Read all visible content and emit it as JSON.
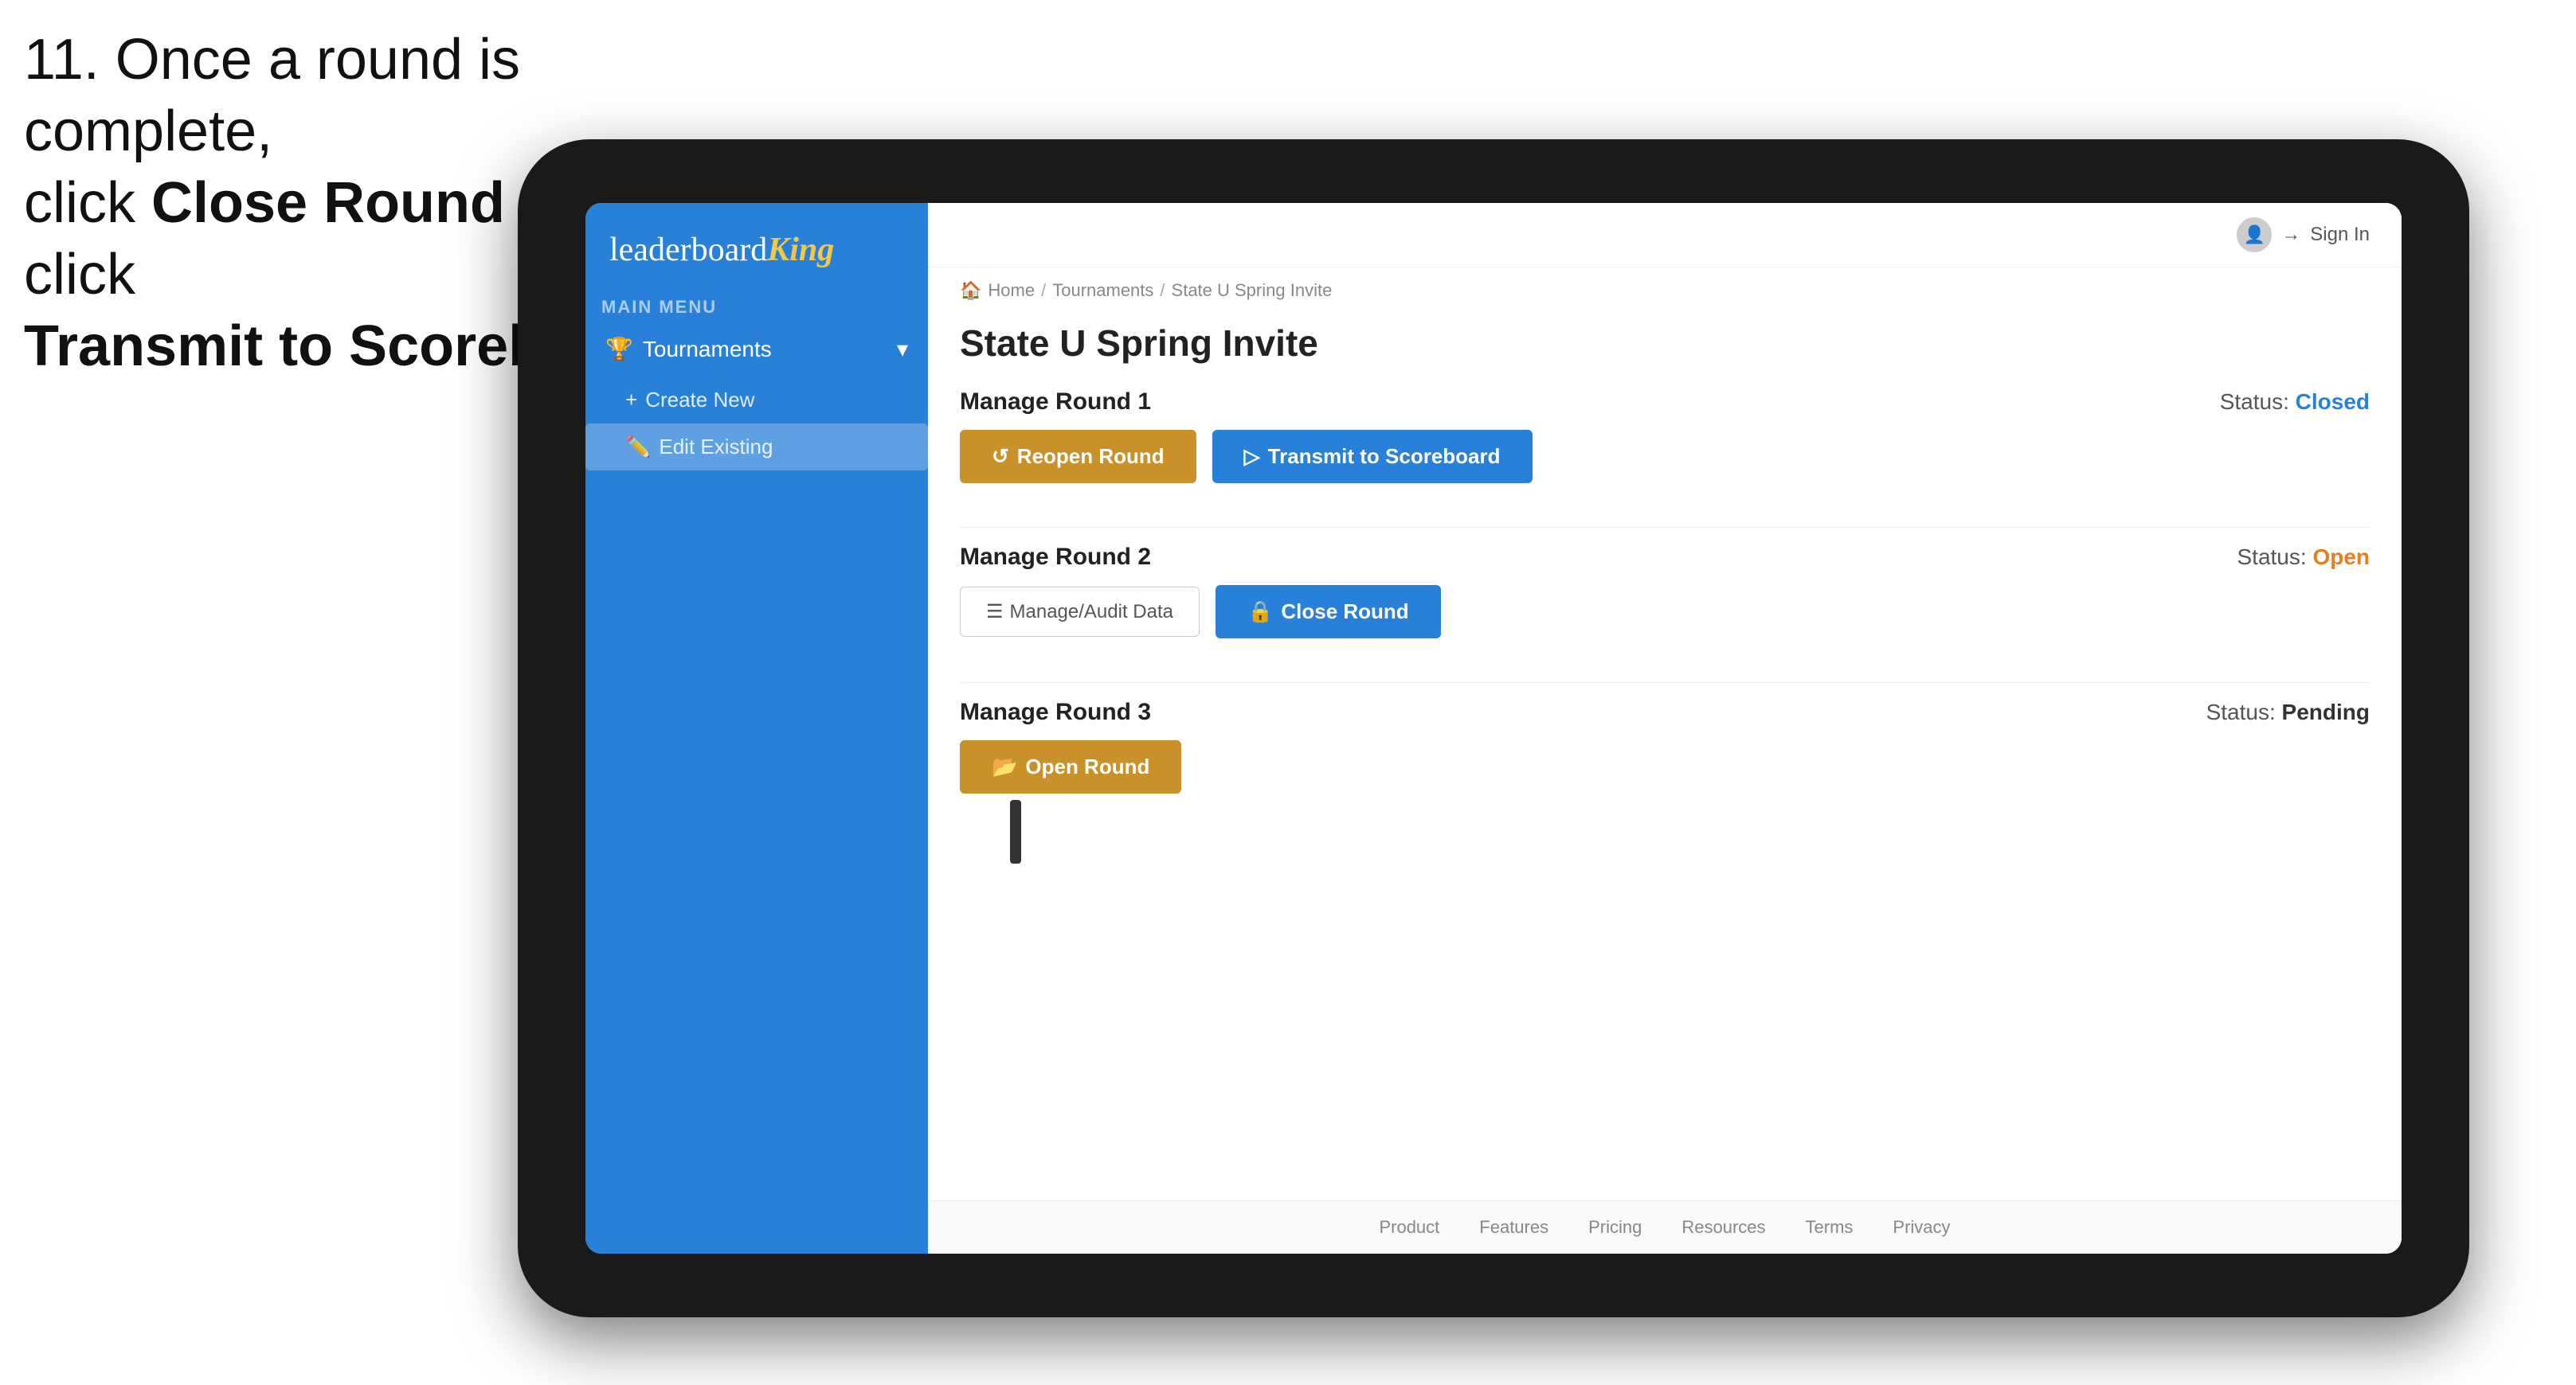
{
  "instruction": {
    "line1": "11. Once a round is complete,",
    "line2_pre": "click ",
    "line2_bold": "Close Round",
    "line2_post": " then click",
    "line3_bold": "Transmit to Scoreboard."
  },
  "logo": {
    "text_plain": "leaderboard",
    "text_styled": "King"
  },
  "sidebar": {
    "main_menu_label": "MAIN MENU",
    "tournaments_label": "Tournaments",
    "create_new_label": "Create New",
    "edit_existing_label": "Edit Existing"
  },
  "header": {
    "sign_in_label": "Sign In"
  },
  "breadcrumb": {
    "home": "Home",
    "sep1": "/",
    "tournaments": "Tournaments",
    "sep2": "/",
    "current": "State U Spring Invite"
  },
  "page": {
    "title": "State U Spring Invite",
    "round1": {
      "label": "Manage Round 1",
      "status_label": "Status:",
      "status_value": "Closed",
      "reopen_label": "Reopen Round",
      "transmit_label": "Transmit to Scoreboard"
    },
    "round2": {
      "label": "Manage Round 2",
      "status_label": "Status:",
      "status_value": "Open",
      "manage_label": "Manage/Audit Data",
      "close_label": "Close Round"
    },
    "round3": {
      "label": "Manage Round 3",
      "status_label": "Status:",
      "status_value": "Pending",
      "open_label": "Open Round"
    }
  },
  "footer": {
    "links": [
      "Product",
      "Features",
      "Pricing",
      "Resources",
      "Terms",
      "Privacy"
    ]
  },
  "colors": {
    "sidebar_bg": "#2980d9",
    "btn_gold": "#c8912a",
    "btn_blue": "#2980d9",
    "status_closed": "#2980d9",
    "status_open": "#e67e22"
  }
}
